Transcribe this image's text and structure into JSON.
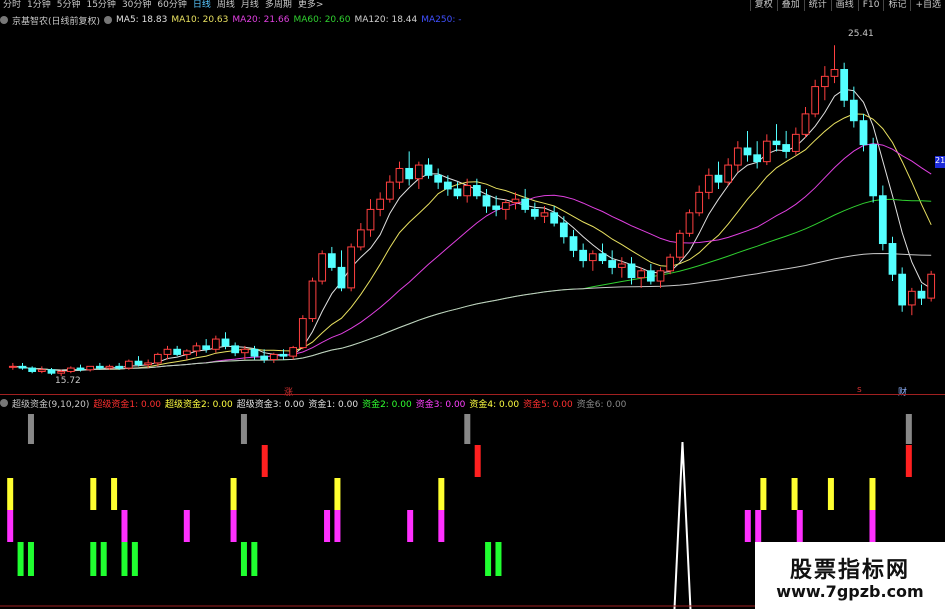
{
  "toolbar": {
    "tabs": [
      "分时",
      "1分钟",
      "5分钟",
      "15分钟",
      "30分钟",
      "60分钟",
      "日线",
      "周线",
      "月线",
      "多周期",
      "更多>"
    ],
    "active_tab": "日线",
    "right_buttons": [
      "复权",
      "叠加",
      "统计",
      "画线",
      "F10",
      "标记",
      "+自选"
    ]
  },
  "stock": {
    "title": "京基智农(日线前复权)"
  },
  "ma_legend": [
    {
      "label": "MA5: 18.83",
      "color": "#e0e0e0"
    },
    {
      "label": "MA10: 20.63",
      "color": "#e8e060"
    },
    {
      "label": "MA20: 21.66",
      "color": "#e040e0"
    },
    {
      "label": "MA60: 20.60",
      "color": "#30d030"
    },
    {
      "label": "MA120: 18.44",
      "color": "#d0d0d0"
    },
    {
      "label": "MA250: -",
      "color": "#4050ff"
    }
  ],
  "indicator_legend": [
    {
      "label": "超级资金(9,10,20)",
      "color": "#c8c8c8"
    },
    {
      "label": "超级资金1: 0.00",
      "color": "#ff3030"
    },
    {
      "label": "超级资金2: 0.00",
      "color": "#ffff40"
    },
    {
      "label": "超级资金3: 0.00",
      "color": "#e0e0e0"
    },
    {
      "label": "资金1: 0.00",
      "color": "#e0e0e0"
    },
    {
      "label": "资金2: 0.00",
      "color": "#30ff30"
    },
    {
      "label": "资金3: 0.00",
      "color": "#ff40ff"
    },
    {
      "label": "资金4: 0.00",
      "color": "#ffff40"
    },
    {
      "label": "资金5: 0.00",
      "color": "#ff3030"
    },
    {
      "label": "资金6: 0.00",
      "color": "#888888"
    }
  ],
  "markers": {
    "zhang": "涨",
    "cai": "财",
    "s": "s"
  },
  "watermark": {
    "cn": "股票指标网",
    "url": "www.7gpzb.com"
  },
  "colors": {
    "up": "#ff4040",
    "down": "#54ffff",
    "ma5": "#e0e0e0",
    "ma10": "#e8e060",
    "ma20": "#e040e0",
    "ma60": "#30d030",
    "ma120": "#c8c8c8"
  },
  "chart_data": {
    "type": "candlestick",
    "high_label": "25.41",
    "low_label": "15.72",
    "right_axis_tag": "21",
    "ohlc": [
      [
        16.0,
        16.1,
        15.9,
        16.0
      ],
      [
        16.0,
        16.1,
        15.9,
        15.95
      ],
      [
        15.95,
        16.0,
        15.8,
        15.85
      ],
      [
        15.85,
        16.0,
        15.8,
        15.9
      ],
      [
        15.9,
        15.95,
        15.75,
        15.8
      ],
      [
        15.8,
        15.9,
        15.72,
        15.85
      ],
      [
        15.85,
        16.0,
        15.8,
        15.95
      ],
      [
        15.95,
        16.05,
        15.85,
        15.9
      ],
      [
        15.9,
        16.0,
        15.85,
        16.0
      ],
      [
        16.0,
        16.1,
        15.9,
        15.95
      ],
      [
        15.95,
        16.05,
        15.9,
        16.0
      ],
      [
        16.0,
        16.1,
        15.9,
        15.95
      ],
      [
        15.95,
        16.2,
        15.9,
        16.15
      ],
      [
        16.15,
        16.3,
        16.0,
        16.05
      ],
      [
        16.05,
        16.2,
        15.95,
        16.1
      ],
      [
        16.1,
        16.4,
        16.0,
        16.35
      ],
      [
        16.35,
        16.6,
        16.2,
        16.5
      ],
      [
        16.5,
        16.6,
        16.3,
        16.35
      ],
      [
        16.35,
        16.5,
        16.2,
        16.45
      ],
      [
        16.45,
        16.7,
        16.3,
        16.6
      ],
      [
        16.6,
        16.8,
        16.4,
        16.5
      ],
      [
        16.5,
        16.9,
        16.4,
        16.8
      ],
      [
        16.8,
        17.0,
        16.5,
        16.6
      ],
      [
        16.6,
        16.7,
        16.3,
        16.4
      ],
      [
        16.4,
        16.6,
        16.2,
        16.5
      ],
      [
        16.5,
        16.6,
        16.2,
        16.3
      ],
      [
        16.3,
        16.5,
        16.1,
        16.2
      ],
      [
        16.2,
        16.4,
        16.1,
        16.35
      ],
      [
        16.35,
        16.5,
        16.2,
        16.3
      ],
      [
        16.3,
        16.6,
        16.2,
        16.55
      ],
      [
        16.55,
        17.5,
        16.5,
        17.4
      ],
      [
        17.4,
        18.6,
        17.3,
        18.5
      ],
      [
        18.5,
        19.4,
        18.4,
        19.3
      ],
      [
        19.3,
        19.5,
        18.8,
        18.9
      ],
      [
        18.9,
        19.4,
        18.2,
        18.3
      ],
      [
        18.3,
        19.6,
        18.2,
        19.5
      ],
      [
        19.5,
        20.2,
        19.4,
        20.0
      ],
      [
        20.0,
        20.9,
        19.8,
        20.6
      ],
      [
        20.6,
        21.1,
        20.4,
        20.9
      ],
      [
        20.9,
        21.6,
        20.8,
        21.4
      ],
      [
        21.4,
        22.0,
        21.2,
        21.8
      ],
      [
        21.8,
        22.3,
        21.3,
        21.5
      ],
      [
        21.5,
        22.0,
        21.2,
        21.9
      ],
      [
        21.9,
        22.1,
        21.5,
        21.6
      ],
      [
        21.6,
        21.8,
        21.2,
        21.4
      ],
      [
        21.4,
        21.6,
        21.0,
        21.2
      ],
      [
        21.2,
        21.4,
        20.9,
        21.0
      ],
      [
        21.0,
        21.5,
        20.8,
        21.3
      ],
      [
        21.3,
        21.5,
        20.9,
        21.0
      ],
      [
        21.0,
        21.2,
        20.5,
        20.7
      ],
      [
        20.7,
        21.0,
        20.4,
        20.6
      ],
      [
        20.6,
        20.9,
        20.3,
        20.8
      ],
      [
        20.8,
        21.1,
        20.6,
        20.9
      ],
      [
        20.9,
        21.2,
        20.5,
        20.6
      ],
      [
        20.6,
        20.8,
        20.3,
        20.4
      ],
      [
        20.4,
        20.7,
        20.2,
        20.5
      ],
      [
        20.5,
        20.7,
        20.1,
        20.2
      ],
      [
        20.2,
        20.4,
        19.6,
        19.8
      ],
      [
        19.8,
        20.0,
        19.2,
        19.4
      ],
      [
        19.4,
        19.6,
        18.9,
        19.1
      ],
      [
        19.1,
        19.4,
        18.8,
        19.3
      ],
      [
        19.3,
        19.6,
        19.0,
        19.1
      ],
      [
        19.1,
        19.4,
        18.7,
        18.9
      ],
      [
        18.9,
        19.2,
        18.6,
        19.0
      ],
      [
        19.0,
        19.2,
        18.4,
        18.6
      ],
      [
        18.6,
        18.9,
        18.3,
        18.8
      ],
      [
        18.8,
        19.0,
        18.4,
        18.5
      ],
      [
        18.5,
        18.9,
        18.3,
        18.8
      ],
      [
        18.8,
        19.3,
        18.7,
        19.2
      ],
      [
        19.2,
        20.0,
        19.1,
        19.9
      ],
      [
        19.9,
        20.6,
        19.8,
        20.5
      ],
      [
        20.5,
        21.3,
        20.4,
        21.1
      ],
      [
        21.1,
        21.8,
        20.9,
        21.6
      ],
      [
        21.6,
        22.0,
        21.2,
        21.4
      ],
      [
        21.4,
        22.1,
        21.3,
        21.9
      ],
      [
        21.9,
        22.6,
        21.7,
        22.4
      ],
      [
        22.4,
        22.9,
        22.0,
        22.2
      ],
      [
        22.2,
        22.6,
        21.8,
        22.0
      ],
      [
        22.0,
        22.8,
        21.9,
        22.6
      ],
      [
        22.6,
        23.1,
        22.3,
        22.5
      ],
      [
        22.5,
        22.9,
        22.1,
        22.3
      ],
      [
        22.3,
        23.0,
        22.2,
        22.8
      ],
      [
        22.8,
        23.6,
        22.7,
        23.4
      ],
      [
        23.4,
        24.4,
        23.3,
        24.2
      ],
      [
        24.2,
        24.8,
        23.8,
        24.5
      ],
      [
        24.5,
        25.41,
        24.3,
        24.7
      ],
      [
        24.7,
        24.9,
        23.6,
        23.8
      ],
      [
        23.8,
        24.2,
        23.0,
        23.2
      ],
      [
        23.2,
        23.4,
        22.3,
        22.5
      ],
      [
        22.5,
        22.7,
        20.8,
        21.0
      ],
      [
        21.0,
        21.3,
        19.4,
        19.6
      ],
      [
        19.6,
        19.8,
        18.5,
        18.7
      ],
      [
        18.7,
        18.9,
        17.6,
        17.8
      ],
      [
        17.8,
        18.3,
        17.5,
        18.2
      ],
      [
        18.2,
        18.4,
        17.8,
        18.0
      ],
      [
        18.0,
        18.8,
        17.9,
        18.7
      ]
    ],
    "indicator_events": {
      "gray": [
        5,
        46,
        89,
        174
      ],
      "red": [
        50,
        91,
        174
      ],
      "yellow": [
        1,
        17,
        21,
        44,
        64,
        84,
        146,
        152,
        159,
        167
      ],
      "magenta": [
        1,
        23,
        35,
        44,
        62,
        64,
        78,
        84,
        143,
        145,
        153,
        167
      ],
      "green": [
        3,
        5,
        17,
        19,
        23,
        25,
        46,
        48,
        93,
        95,
        175,
        177
      ],
      "white_spike": 131
    }
  }
}
